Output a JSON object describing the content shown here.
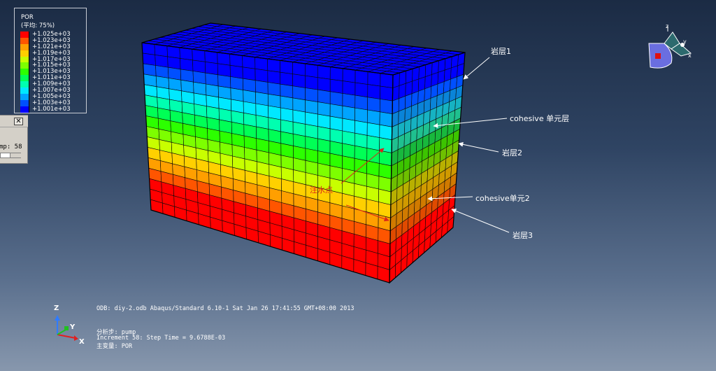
{
  "legend": {
    "title": "POR",
    "subtitle": "(平均: 75%)",
    "entries": [
      {
        "label": "+1.025e+03",
        "color": "#ff0000"
      },
      {
        "label": "+1.023e+03",
        "color": "#ff5500"
      },
      {
        "label": "+1.021e+03",
        "color": "#ff9f00"
      },
      {
        "label": "+1.019e+03",
        "color": "#ffd000"
      },
      {
        "label": "+1.017e+03",
        "color": "#c8ff00"
      },
      {
        "label": "+1.015e+03",
        "color": "#7dff00"
      },
      {
        "label": "+1.013e+03",
        "color": "#2cff00"
      },
      {
        "label": "+1.011e+03",
        "color": "#00ff55"
      },
      {
        "label": "+1.009e+03",
        "color": "#00ffb0"
      },
      {
        "label": "+1.007e+03",
        "color": "#00e8ff"
      },
      {
        "label": "+1.005e+03",
        "color": "#00a4ff"
      },
      {
        "label": "+1.003e+03",
        "color": "#0050ff"
      },
      {
        "label": "+1.001e+03",
        "color": "#0000ff"
      }
    ]
  },
  "dialog": {
    "close_label": "✕",
    "step_text": "mp: 58"
  },
  "annotations": {
    "layer1": "岩层1",
    "cohesive_layer": "cohesive 单元层",
    "layer2": "岩层2",
    "cohesive2": "cohesive单元2",
    "layer3": "岩层3",
    "injection_point": "注水点"
  },
  "info": {
    "odb_line": "ODB: diy-2.odb   Abaqus/Standard 6.10-1   Sat Jan 26 17:41:55 GMT+08:00 2013",
    "step_line": "分析步: pump",
    "increment_line": "Increment    58: Step Time =   9.6788E-03",
    "variable_line": "主变量: POR"
  },
  "triad": {
    "z": "Z",
    "y": "Y",
    "x": "X"
  },
  "view_cube": {
    "z": "z",
    "y": "y",
    "x": "x"
  },
  "model": {
    "front_band_colors": [
      "#0000ff",
      "#0000ff",
      "#0050ff",
      "#00a4ff",
      "#00e8ff",
      "#00ffb0",
      "#00ff55",
      "#2cff00",
      "#7dff00",
      "#c8ff00",
      "#ffd000",
      "#ff9f00",
      "#ff5500",
      "#ff0000",
      "#ff0000",
      "#ff0000"
    ],
    "side_band_colors": [
      "#0000ff",
      "#0000ff",
      "#0050ff",
      "#0a84d8",
      "#16b2c2",
      "#1fc08f",
      "#18b83d",
      "#3cc400",
      "#6ec000",
      "#b8b000",
      "#d09a00",
      "#d07a00",
      "#e04a00",
      "#ff0000",
      "#ff0000",
      "#ff0000"
    ],
    "top_color": "#0000ff",
    "highlight_color": "#d8241a"
  }
}
